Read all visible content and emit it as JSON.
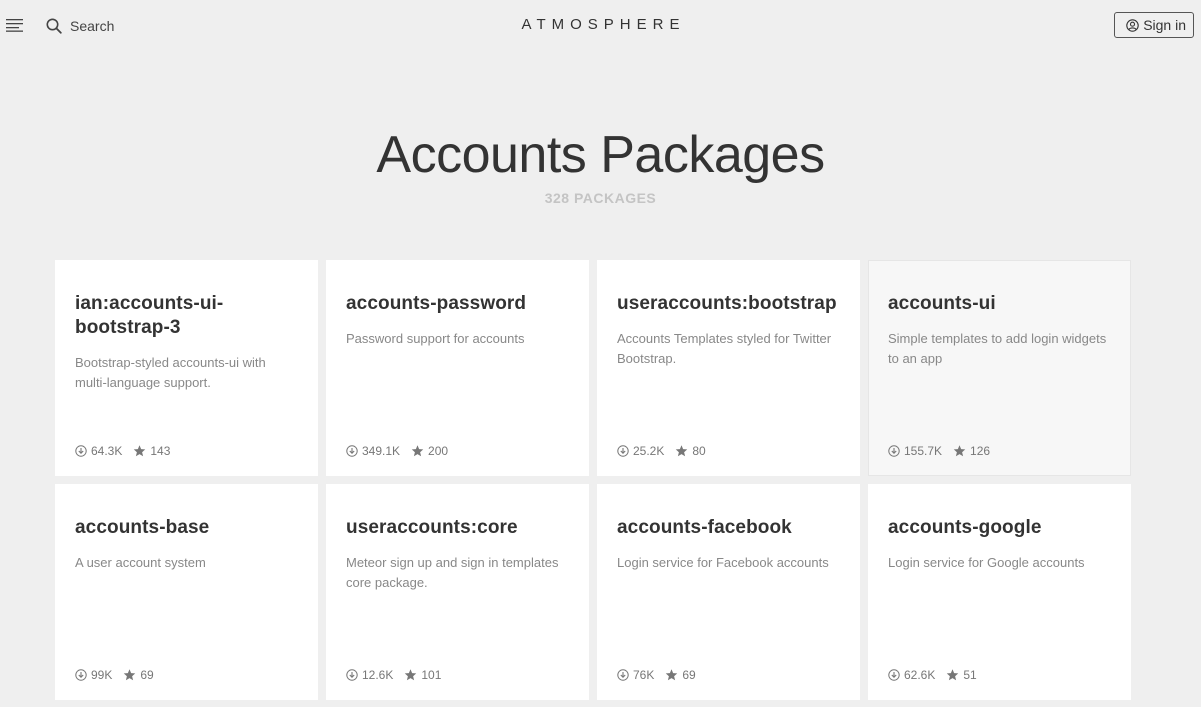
{
  "header": {
    "menu_icon": "hamburger-icon",
    "search_label": "Search",
    "brand": "ATMOSPHERE",
    "signin_label": "Sign in"
  },
  "hero": {
    "title": "Accounts Packages",
    "count": "328 PACKAGES"
  },
  "packages": [
    {
      "name": "ian:accounts-ui-bootstrap-3",
      "desc": "Bootstrap-styled accounts-ui with multi-language support.",
      "installs": "64.3K",
      "stars": "143"
    },
    {
      "name": "accounts-password",
      "desc": "Password support for accounts",
      "installs": "349.1K",
      "stars": "200"
    },
    {
      "name": "useraccounts:bootstrap",
      "desc": "Accounts Templates styled for Twitter Bootstrap.",
      "installs": "25.2K",
      "stars": "80"
    },
    {
      "name": "accounts-ui",
      "desc": "Simple templates to add login widgets to an app",
      "installs": "155.7K",
      "stars": "126"
    },
    {
      "name": "accounts-base",
      "desc": "A user account system",
      "installs": "99K",
      "stars": "69"
    },
    {
      "name": "useraccounts:core",
      "desc": "Meteor sign up and sign in templates core package.",
      "installs": "12.6K",
      "stars": "101"
    },
    {
      "name": "accounts-facebook",
      "desc": "Login service for Facebook accounts",
      "installs": "76K",
      "stars": "69"
    },
    {
      "name": "accounts-google",
      "desc": "Login service for Google accounts",
      "installs": "62.6K",
      "stars": "51"
    }
  ],
  "colors": {
    "background": "#efefef",
    "card": "#ffffff",
    "card_hover": "#f7f7f7",
    "muted_text": "#888888",
    "count_text": "#c4c4c4"
  }
}
